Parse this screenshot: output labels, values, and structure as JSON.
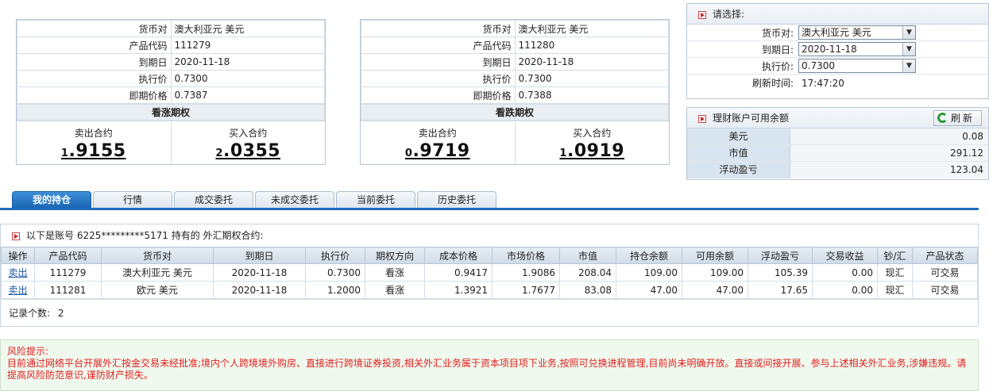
{
  "cards": [
    {
      "rows": [
        {
          "key": "货币对",
          "value": "澳大利亚元 美元"
        },
        {
          "key": "产品代码",
          "value": "111279"
        },
        {
          "key": "到期日",
          "value": "2020-11-18"
        },
        {
          "key": "执行价",
          "value": "0.7300"
        },
        {
          "key": "即期价格",
          "value": "0.7387"
        }
      ],
      "title": "看涨期权",
      "sell_label": "卖出合约",
      "sell_big": "1",
      "sell_rest": ".9155",
      "buy_label": "买入合约",
      "buy_big": "2",
      "buy_rest": ".0355"
    },
    {
      "rows": [
        {
          "key": "货币对",
          "value": "澳大利亚元 美元"
        },
        {
          "key": "产品代码",
          "value": "111280"
        },
        {
          "key": "到期日",
          "value": "2020-11-18"
        },
        {
          "key": "执行价",
          "value": "0.7300"
        },
        {
          "key": "即期价格",
          "value": "0.7388"
        }
      ],
      "title": "看跌期权",
      "sell_label": "卖出合约",
      "sell_big": "0",
      "sell_rest": ".9719",
      "buy_label": "买入合约",
      "buy_big": "1",
      "buy_rest": ".0919"
    }
  ],
  "selector": {
    "title": "请选择:",
    "pair_label": "货币对:",
    "pair_value": "澳大利亚元 美元",
    "date_label": "到期日:",
    "date_value": "2020-11-18",
    "strike_label": "执行价:",
    "strike_value": "0.7300",
    "refresh_label": "刷新时间:",
    "refresh_value": "17:47:20"
  },
  "balance": {
    "title": "理财账户可用余额",
    "refresh_button": "刷新",
    "rows": [
      {
        "key": "美元",
        "value": "0.08"
      },
      {
        "key": "市值",
        "value": "291.12"
      },
      {
        "key": "浮动盈亏",
        "value": "123.04"
      }
    ]
  },
  "tabs": [
    "我的持仓",
    "行情",
    "成交委托",
    "未成交委托",
    "当前委托",
    "历史委托"
  ],
  "holdings": {
    "caption": "以下是账号 6225*********5171 持有的 外汇期权合约:",
    "headers": [
      "操作",
      "产品代码",
      "货币对",
      "到期日",
      "执行价",
      "期权方向",
      "成本价格",
      "市场价格",
      "市值",
      "持仓余额",
      "可用余额",
      "浮动盈亏",
      "交易收益",
      "钞/汇",
      "产品状态"
    ],
    "rows": [
      [
        "卖出",
        "111279",
        "澳大利亚元 美元",
        "2020-11-18",
        "0.7300",
        "看涨",
        "0.9417",
        "1.9086",
        "208.04",
        "109.00",
        "109.00",
        "105.39",
        "0.00",
        "现汇",
        "可交易"
      ],
      [
        "卖出",
        "111281",
        "欧元 美元",
        "2020-11-18",
        "1.2000",
        "看涨",
        "1.3921",
        "1.7677",
        "83.08",
        "47.00",
        "47.00",
        "17.65",
        "0.00",
        "现汇",
        "可交易"
      ]
    ],
    "count_label": "记录个数:",
    "count_value": "2"
  },
  "risk": {
    "title": "风险提示:",
    "text": "目前通过网络平台开展外汇按金交易未经批准;境内个人跨境境外购房、直接进行跨境证券投资,相关外汇业务属于资本项目项下业务,按照可兑换进程管理,目前尚未明确开放。直接或间接开展、参与上述相关外汇业务,涉嫌违规。请提高风险防范意识,谨防财产损失。"
  }
}
